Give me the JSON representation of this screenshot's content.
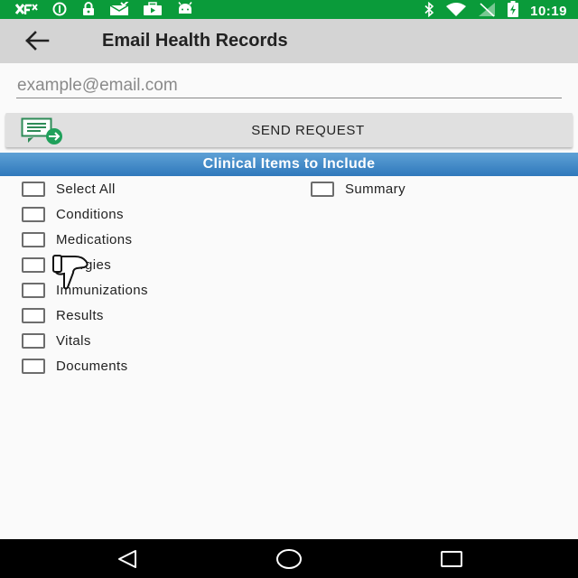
{
  "status_bar": {
    "time": "10:19",
    "left_icons": [
      "fx-notification-icon",
      "data-saver-icon",
      "lock-icon",
      "mail-check-icon",
      "briefcase-play-icon",
      "android-icon"
    ],
    "right_icons": [
      "bluetooth-icon",
      "wifi-icon",
      "signal-icon",
      "battery-charging-icon"
    ],
    "color": "#0a9b3a"
  },
  "app_bar": {
    "title": "Email Health Records",
    "back_icon": "back-arrow-icon"
  },
  "email_field": {
    "value": "",
    "placeholder": "example@email.com"
  },
  "send_button": {
    "label": "SEND REQUEST",
    "icon": "send-message-icon"
  },
  "section": {
    "title": "Clinical Items to Include",
    "color": "#2f78bb"
  },
  "checkboxes": {
    "select_all": "Select All",
    "summary": "Summary",
    "conditions": "Conditions",
    "medications": "Medications",
    "allergies": "Allergies",
    "immunizations": "Immunizations",
    "results": "Results",
    "vitals": "Vitals",
    "documents": "Documents"
  },
  "nav_bar": {
    "icons": [
      "back-triangle-icon",
      "home-circle-icon",
      "recents-square-icon"
    ]
  }
}
